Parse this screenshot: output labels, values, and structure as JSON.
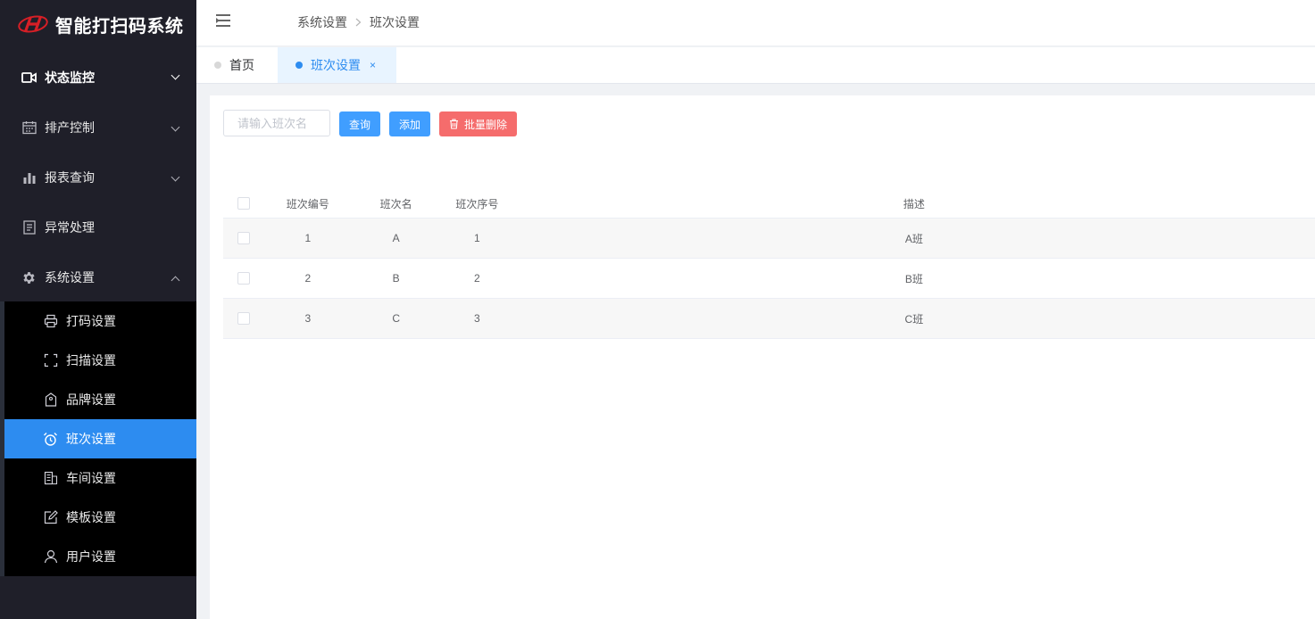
{
  "app": {
    "title": "智能打扫码系统"
  },
  "sidebar": {
    "menus": [
      {
        "label": "状态监控",
        "icon": "camera-icon"
      },
      {
        "label": "排产控制",
        "icon": "calendar-icon"
      },
      {
        "label": "报表查询",
        "icon": "bar-chart-icon"
      },
      {
        "label": "异常处理",
        "icon": "document-icon"
      },
      {
        "label": "系统设置",
        "icon": "gear-icon"
      }
    ],
    "submenu": [
      {
        "label": "打码设置",
        "icon": "printer-icon"
      },
      {
        "label": "扫描设置",
        "icon": "scan-icon"
      },
      {
        "label": "品牌设置",
        "icon": "tag-icon"
      },
      {
        "label": "班次设置",
        "icon": "alarm-clock-icon",
        "active": true
      },
      {
        "label": "车间设置",
        "icon": "building-icon"
      },
      {
        "label": "模板设置",
        "icon": "edit-icon"
      },
      {
        "label": "用户设置",
        "icon": "user-icon"
      }
    ]
  },
  "header": {
    "breadcrumb": {
      "parent": "系统设置",
      "current": "班次设置"
    }
  },
  "tabs": {
    "home": "首页",
    "active": "班次设置",
    "close": "×"
  },
  "toolbar": {
    "search_placeholder": "请输入班次名",
    "query_label": "查询",
    "add_label": "添加",
    "batch_delete_label": "批量删除"
  },
  "table": {
    "headers": {
      "no": "班次编号",
      "name": "班次名",
      "seq": "班次序号",
      "desc": "描述"
    },
    "rows": [
      {
        "no": "1",
        "name": "A",
        "seq": "1",
        "desc": "A班"
      },
      {
        "no": "2",
        "name": "B",
        "seq": "2",
        "desc": "B班"
      },
      {
        "no": "3",
        "name": "C",
        "seq": "3",
        "desc": "C班"
      }
    ]
  },
  "colors": {
    "sidebar_bg": "#1f1f29",
    "active": "#2d8cf0",
    "primary_button": "#409eff",
    "danger_button": "#f56c6c",
    "logo_red": "#d61f26"
  }
}
